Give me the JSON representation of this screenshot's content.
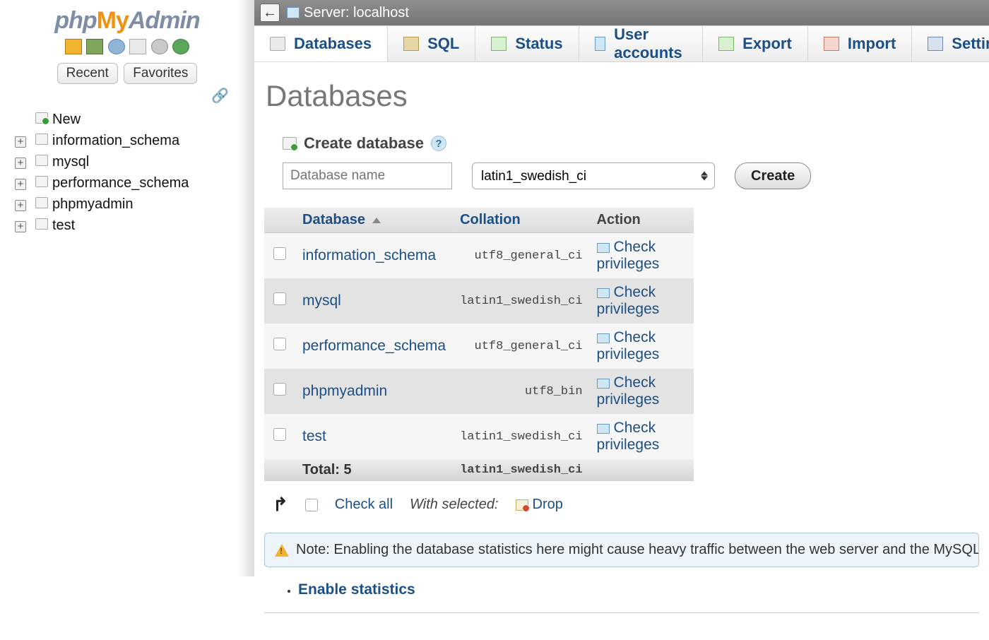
{
  "logo": {
    "php": "php",
    "my": "My",
    "admin": "Admin"
  },
  "sidebar": {
    "recent_label": "Recent",
    "favorites_label": "Favorites",
    "new_label": "New",
    "items": [
      {
        "name": "information_schema"
      },
      {
        "name": "mysql"
      },
      {
        "name": "performance_schema"
      },
      {
        "name": "phpmyadmin"
      },
      {
        "name": "test"
      }
    ]
  },
  "breadcrumb": {
    "server_label": "Server:",
    "server_name": "localhost"
  },
  "tabs": [
    {
      "label": "Databases"
    },
    {
      "label": "SQL"
    },
    {
      "label": "Status"
    },
    {
      "label": "User accounts"
    },
    {
      "label": "Export"
    },
    {
      "label": "Import"
    },
    {
      "label": "Settings"
    }
  ],
  "page_title": "Databases",
  "create": {
    "heading": "Create database",
    "placeholder": "Database name",
    "collation_selected": "latin1_swedish_ci",
    "button": "Create"
  },
  "table": {
    "headers": {
      "database": "Database",
      "collation": "Collation",
      "action": "Action"
    },
    "rows": [
      {
        "name": "information_schema",
        "collation": "utf8_general_ci",
        "action": "Check privileges"
      },
      {
        "name": "mysql",
        "collation": "latin1_swedish_ci",
        "action": "Check privileges"
      },
      {
        "name": "performance_schema",
        "collation": "utf8_general_ci",
        "action": "Check privileges"
      },
      {
        "name": "phpmyadmin",
        "collation": "utf8_bin",
        "action": "Check privileges"
      },
      {
        "name": "test",
        "collation": "latin1_swedish_ci",
        "action": "Check privileges"
      }
    ],
    "footer": {
      "total_label": "Total: 5",
      "collation": "latin1_swedish_ci"
    }
  },
  "bulk": {
    "check_all": "Check all",
    "with_selected": "With selected:",
    "drop": "Drop"
  },
  "note_text": "Note: Enabling the database statistics here might cause heavy traffic between the web server and the MySQL se",
  "enable_stats": "Enable statistics"
}
